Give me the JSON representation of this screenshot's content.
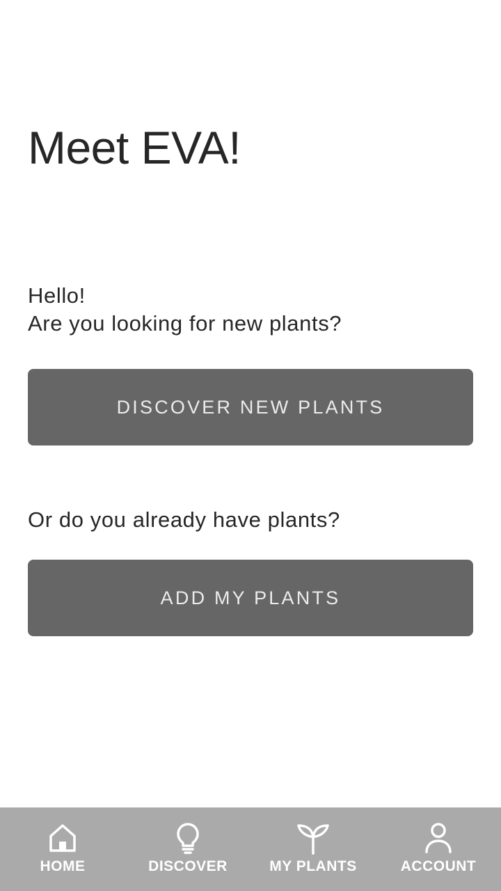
{
  "header": {
    "title": "Meet EVA!"
  },
  "intro": {
    "greeting": "Hello!",
    "question": "Are you looking for new plants?"
  },
  "discover_button": {
    "label": "DISCOVER NEW PLANTS"
  },
  "existing": {
    "question": "Or do you already have plants?"
  },
  "add_button": {
    "label": "ADD MY PLANTS"
  },
  "bottom_nav": {
    "items": [
      {
        "label": "HOME",
        "icon": "home-icon"
      },
      {
        "label": "DISCOVER",
        "icon": "lightbulb-icon"
      },
      {
        "label": "MY PLANTS",
        "icon": "sprout-icon"
      },
      {
        "label": "ACCOUNT",
        "icon": "person-icon"
      }
    ]
  },
  "colors": {
    "background": "#ffffff",
    "text": "#262626",
    "button_bg": "#666666",
    "button_text": "#ececec",
    "nav_bg": "#aaaaaa",
    "nav_text": "#ffffff"
  }
}
